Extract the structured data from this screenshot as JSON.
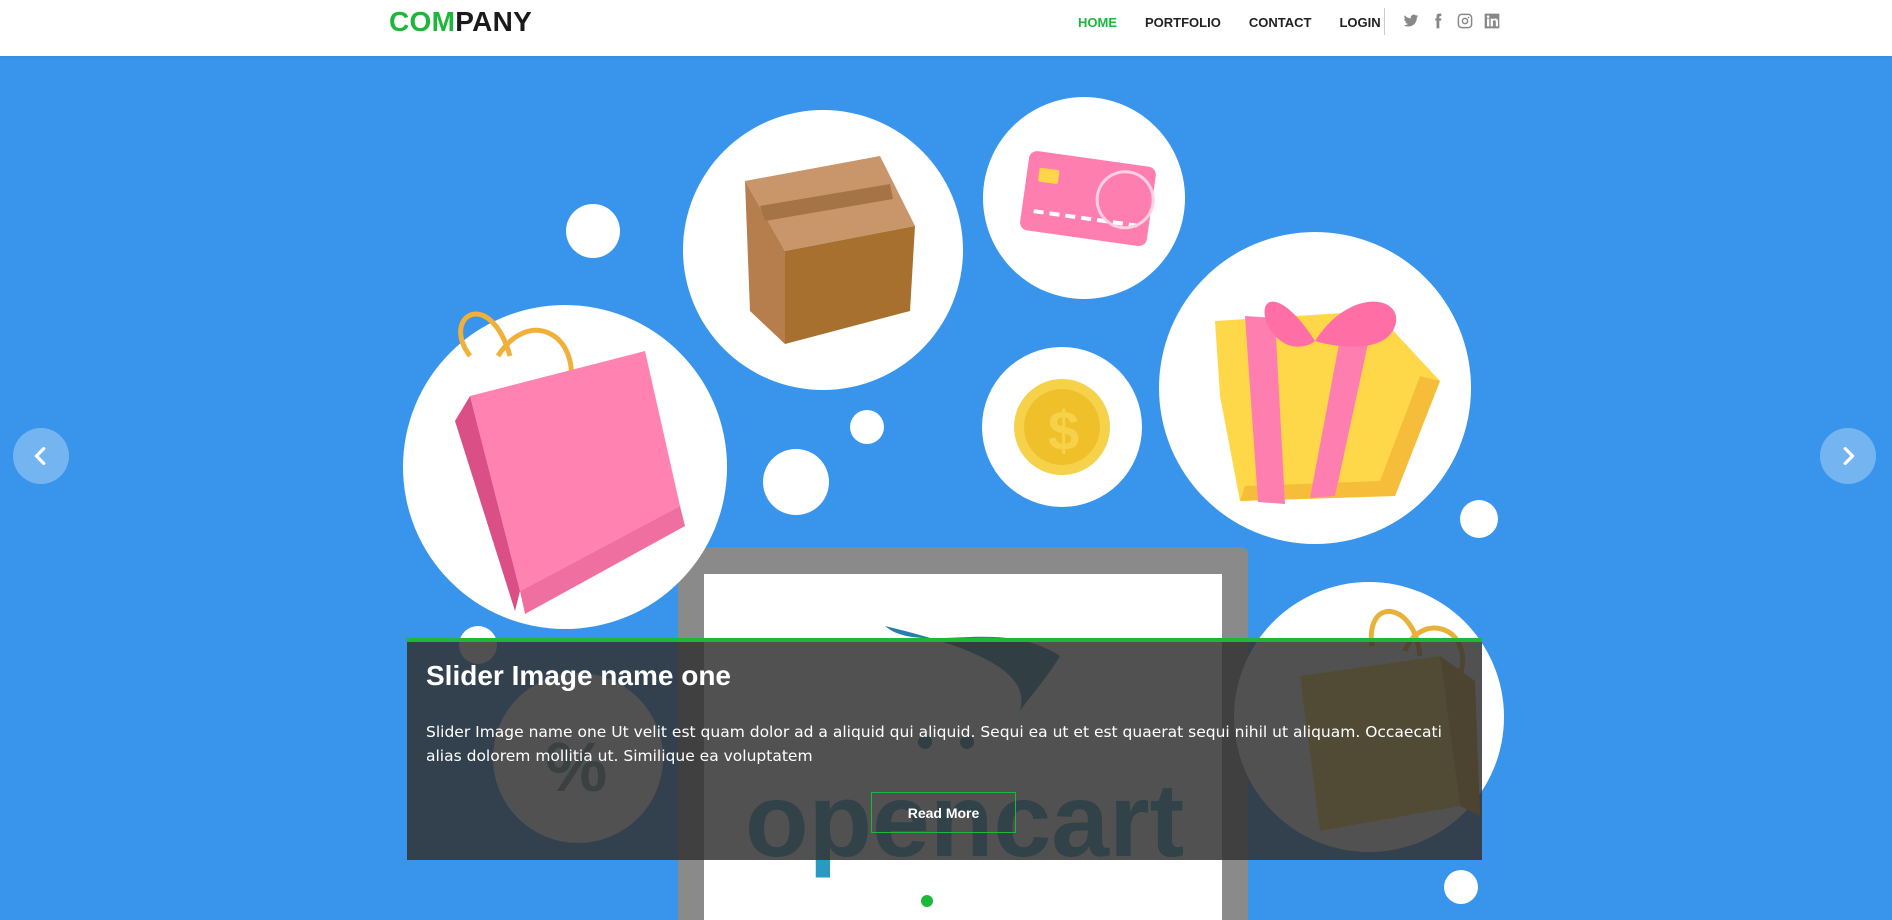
{
  "header": {
    "logo_part1": "COM",
    "logo_part2": "PANY",
    "nav": [
      {
        "label": "HOME",
        "active": true
      },
      {
        "label": "PORTFOLIO",
        "active": false
      },
      {
        "label": "CONTACT",
        "active": false
      },
      {
        "label": "LOGIN",
        "active": false
      }
    ],
    "social_icons": [
      "twitter-icon",
      "facebook-icon",
      "instagram-icon",
      "linkedin-icon"
    ]
  },
  "slider": {
    "slide_title": "Slider Image name one",
    "slide_text": "Slider Image name one Ut velit est quam dolor ad a aliquid qui aliquid. Sequi ea ut et est quaerat sequi nihil ut aliquam. Occaecati alias dolorem mollitia ut. Similique ea voluptatem",
    "button_label": "Read More",
    "image_brand_text": "opencart",
    "image_symbol": "%",
    "active_slide": 1,
    "slide_count": 1
  },
  "colors": {
    "accent": "#1db83a",
    "slider_bg": "#3995eb",
    "caption_bg": "rgba(50,50,50,0.85)",
    "nav_text": "#222222"
  }
}
